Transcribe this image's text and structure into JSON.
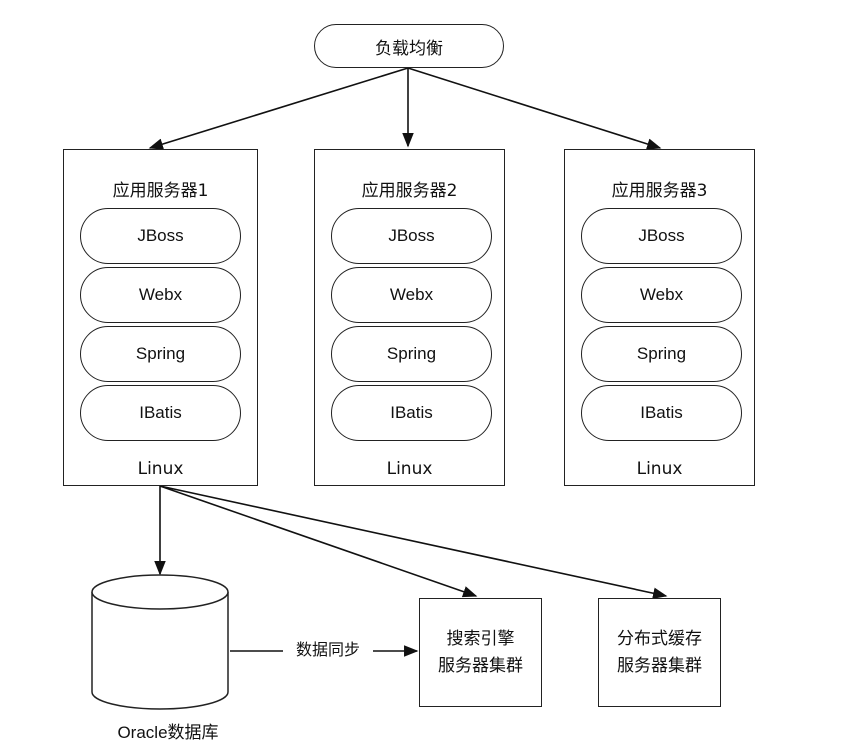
{
  "load_balancer": "负载均衡",
  "servers": [
    {
      "title": "应用服务器1",
      "layers": [
        "JBoss",
        "Webx",
        "Spring",
        "IBatis"
      ],
      "os": "Linux"
    },
    {
      "title": "应用服务器2",
      "layers": [
        "JBoss",
        "Webx",
        "Spring",
        "IBatis"
      ],
      "os": "Linux"
    },
    {
      "title": "应用服务器3",
      "layers": [
        "JBoss",
        "Webx",
        "Spring",
        "IBatis"
      ],
      "os": "Linux"
    }
  ],
  "database": "Oracle数据库",
  "sync_label": "数据同步",
  "search_cluster": {
    "line1": "搜索引擎",
    "line2": "服务器集群"
  },
  "cache_cluster": {
    "line1": "分布式缓存",
    "line2": "服务器集群"
  },
  "colors": {
    "stroke": "#222222",
    "background": "#ffffff",
    "text": "#111111"
  }
}
